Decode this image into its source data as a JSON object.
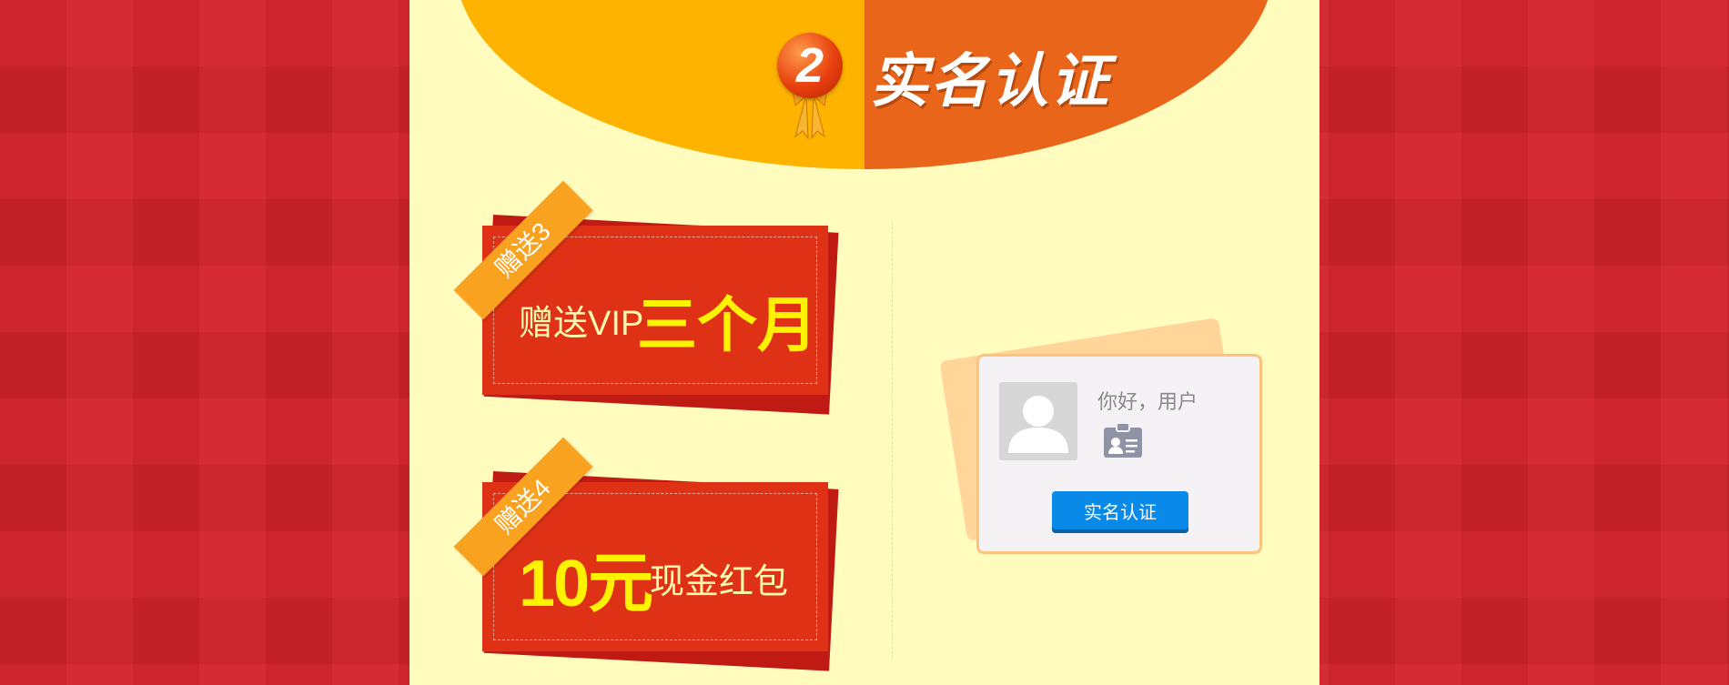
{
  "header": {
    "step_number": "2",
    "title": "实名认证"
  },
  "coupons": [
    {
      "ribbon": "赠送3",
      "small_text": "赠送VIP",
      "big_text": "三个月"
    },
    {
      "ribbon": "赠送4",
      "big_text": "10元",
      "small_text": "现金红包"
    }
  ],
  "user_card": {
    "greeting": "你好，用户",
    "button_label": "实名认证"
  },
  "colors": {
    "background_red": "#d3232d",
    "panel_yellow": "#fffcbd",
    "half_circle_left": "#feb300",
    "half_circle_right": "#e8651a",
    "coupon_red": "#de3115",
    "ribbon_orange": "#f8a21f",
    "button_blue": "#0a8ae8"
  },
  "icons": [
    "medal-icon",
    "avatar-icon",
    "id-card-icon"
  ]
}
